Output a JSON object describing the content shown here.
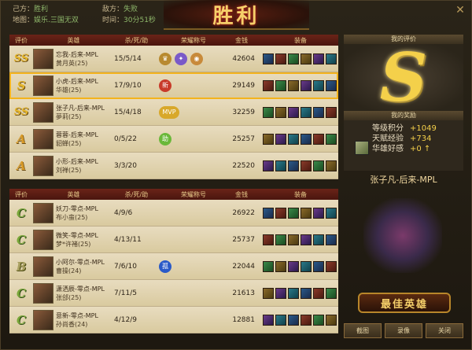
{
  "header": {
    "own_side_label": "己方：",
    "own_result": "胜利",
    "enemy_side_label": "敌方：",
    "enemy_result": "失败",
    "map_label": "地图：",
    "map_value": "娱乐.三国无双",
    "time_label": "时间：",
    "time_value": "30分51秒",
    "banner": "胜利"
  },
  "columns": {
    "eval": "评价",
    "hero": "英雄",
    "kda": "杀/死/助",
    "honor": "荣耀称号",
    "gold": "金钱",
    "equip": "装备"
  },
  "team_a": [
    {
      "grade": "SS",
      "name": "忘我-后来-MPL",
      "hero": "黄月英(25)",
      "kda": "15/5/14",
      "honors": [
        "crown",
        "gem",
        "hero"
      ],
      "gold": "42604",
      "highlight": false
    },
    {
      "grade": "S",
      "name": "小虎-后来-MPL",
      "hero": "华雄(25)",
      "kda": "17/9/10",
      "honors": [
        "new"
      ],
      "honor_text": "新",
      "gold": "29149",
      "highlight": true
    },
    {
      "grade": "SS",
      "name": "张子凡-后来-MPL",
      "hero": "夢莉(25)",
      "kda": "15/4/18",
      "honors": [
        "mvp"
      ],
      "honor_text": "MVP",
      "gold": "32259",
      "highlight": false
    },
    {
      "grade": "A",
      "name": "蓉蓉-后来-MPL",
      "hero": "貂蝉(25)",
      "kda": "0/5/22",
      "honors": [
        "assist"
      ],
      "honor_text": "助",
      "gold": "25257",
      "highlight": false
    },
    {
      "grade": "A",
      "name": "小形-后来-MPL",
      "hero": "刘禅(25)",
      "kda": "3/3/20",
      "honors": [],
      "gold": "22520",
      "highlight": false
    }
  ],
  "team_b": [
    {
      "grade": "C",
      "name": "妖刀-零点-MPL",
      "hero": "布小蛮(25)",
      "kda": "4/9/6",
      "honors": [],
      "gold": "26922",
      "highlight": false
    },
    {
      "grade": "C",
      "name": "微笑-零点-MPL",
      "hero": "梦*许褚(25)",
      "kda": "4/13/11",
      "honors": [],
      "gold": "25737",
      "highlight": false
    },
    {
      "grade": "B",
      "name": "小阿尔-零点-MPL",
      "hero": "曹操(24)",
      "kda": "7/6/10",
      "honors": [
        "lone"
      ],
      "honor_text": "孤",
      "gold": "22044",
      "highlight": false
    },
    {
      "grade": "C",
      "name": "潇洒辰-零点-MPL",
      "hero": "张郃(25)",
      "kda": "7/11/5",
      "honors": [],
      "gold": "21613",
      "highlight": false
    },
    {
      "grade": "C",
      "name": "意新-零点-MPL",
      "hero": "孙尚香(24)",
      "kda": "4/12/9",
      "honors": [],
      "gold": "12881",
      "highlight": false
    }
  ],
  "right_panel": {
    "my_eval_title": "我的评价",
    "my_grade": "S",
    "reward_title": "我的奖励",
    "rewards": [
      {
        "label": "等级积分",
        "value": "+1049"
      },
      {
        "label": "天赋经验",
        "value": "+734"
      },
      {
        "label": "华雄好感",
        "value": "+0 ↑"
      }
    ],
    "mvp_name": "张子凡-后来-MPL",
    "mvp_banner": "最佳英雄"
  },
  "buttons": {
    "screenshot": "截图",
    "replay": "录像",
    "close": "关闭"
  },
  "colors": {
    "win_green": "#8fb86b",
    "highlight_gold": "#f3b31c",
    "table_header": "#6a2418"
  }
}
